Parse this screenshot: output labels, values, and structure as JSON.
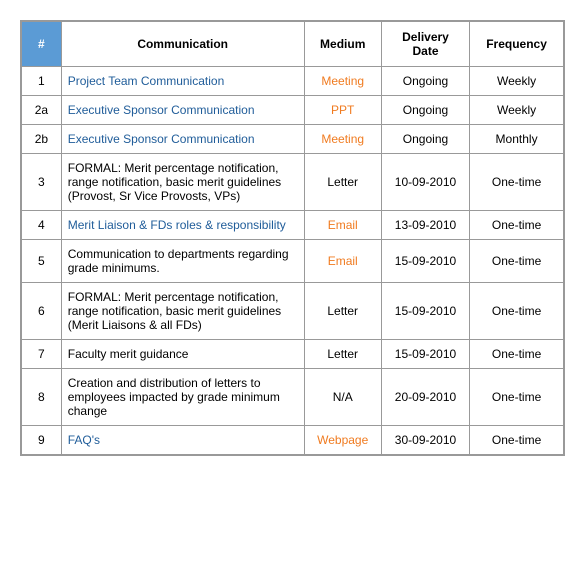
{
  "table": {
    "headers": {
      "hash": "#",
      "communication": "Communication",
      "medium": "Medium",
      "delivery_date": "Delivery Date",
      "frequency": "Frequency"
    },
    "rows": [
      {
        "num": "1",
        "communication": "Project Team Communication",
        "communication_link": true,
        "medium": "Meeting",
        "medium_class": "medium-meeting",
        "delivery_date": "Ongoing",
        "frequency": "Weekly"
      },
      {
        "num": "2a",
        "communication": "Executive Sponsor Communication",
        "communication_link": true,
        "medium": "PPT",
        "medium_class": "medium-ppt",
        "delivery_date": "Ongoing",
        "frequency": "Weekly"
      },
      {
        "num": "2b",
        "communication": "Executive Sponsor Communication",
        "communication_link": true,
        "medium": "Meeting",
        "medium_class": "medium-meeting",
        "delivery_date": "Ongoing",
        "frequency": "Monthly"
      },
      {
        "num": "3",
        "communication": "FORMAL: Merit percentage notification, range notification, basic merit guidelines (Provost, Sr Vice Provosts, VPs)",
        "communication_link": false,
        "medium": "Letter",
        "medium_class": "medium-letter",
        "delivery_date": "10-09-2010",
        "frequency": "One-time"
      },
      {
        "num": "4",
        "communication": "Merit Liaison & FDs roles & responsibility",
        "communication_link": true,
        "medium": "Email",
        "medium_class": "medium-email",
        "delivery_date": "13-09-2010",
        "frequency": "One-time"
      },
      {
        "num": "5",
        "communication": "Communication to departments regarding grade minimums.",
        "communication_link": false,
        "medium": "Email",
        "medium_class": "medium-email",
        "delivery_date": "15-09-2010",
        "frequency": "One-time"
      },
      {
        "num": "6",
        "communication": "FORMAL: Merit percentage notification, range notification, basic merit guidelines (Merit Liaisons & all FDs)",
        "communication_link": false,
        "medium": "Letter",
        "medium_class": "medium-letter",
        "delivery_date": "15-09-2010",
        "frequency": "One-time"
      },
      {
        "num": "7",
        "communication": "Faculty merit guidance",
        "communication_link": false,
        "medium": "Letter",
        "medium_class": "medium-letter",
        "delivery_date": "15-09-2010",
        "frequency": "One-time"
      },
      {
        "num": "8",
        "communication": "Creation and distribution of letters to employees impacted by grade minimum change",
        "communication_link": false,
        "medium": "N/A",
        "medium_class": "medium-na",
        "delivery_date": "20-09-2010",
        "frequency": "One-time"
      },
      {
        "num": "9",
        "communication": "FAQ's",
        "communication_link": true,
        "medium": "Webpage",
        "medium_class": "medium-webpage",
        "delivery_date": "30-09-2010",
        "frequency": "One-time"
      }
    ]
  }
}
